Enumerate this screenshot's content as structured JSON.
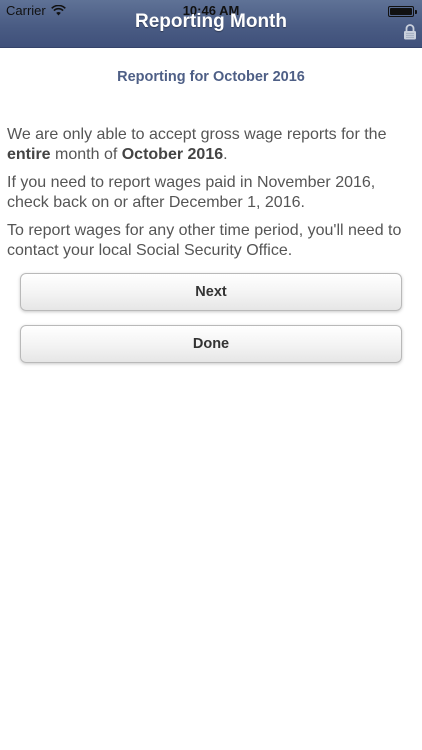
{
  "status_bar": {
    "carrier": "Carrier",
    "time": "10:46 AM",
    "battery_level": 1.0
  },
  "header": {
    "title": "Reporting Month",
    "lock_icon": "lock-icon",
    "color": "#4a5c84"
  },
  "content": {
    "subtitle": "Reporting for October 2016",
    "p1": {
      "before_bold": "We are only able to accept gross wage reports for the ",
      "bold_1": "entire",
      "middle": " month of ",
      "bold_2": "October 2016",
      "after": "."
    },
    "p2": "If you need to report wages paid in November 2016, check back on or after December 1, 2016.",
    "p3": "To report wages for any other time period, you'll need to contact your local Social Security Office."
  },
  "buttons": {
    "next_label": "Next",
    "done_label": "Done"
  }
}
